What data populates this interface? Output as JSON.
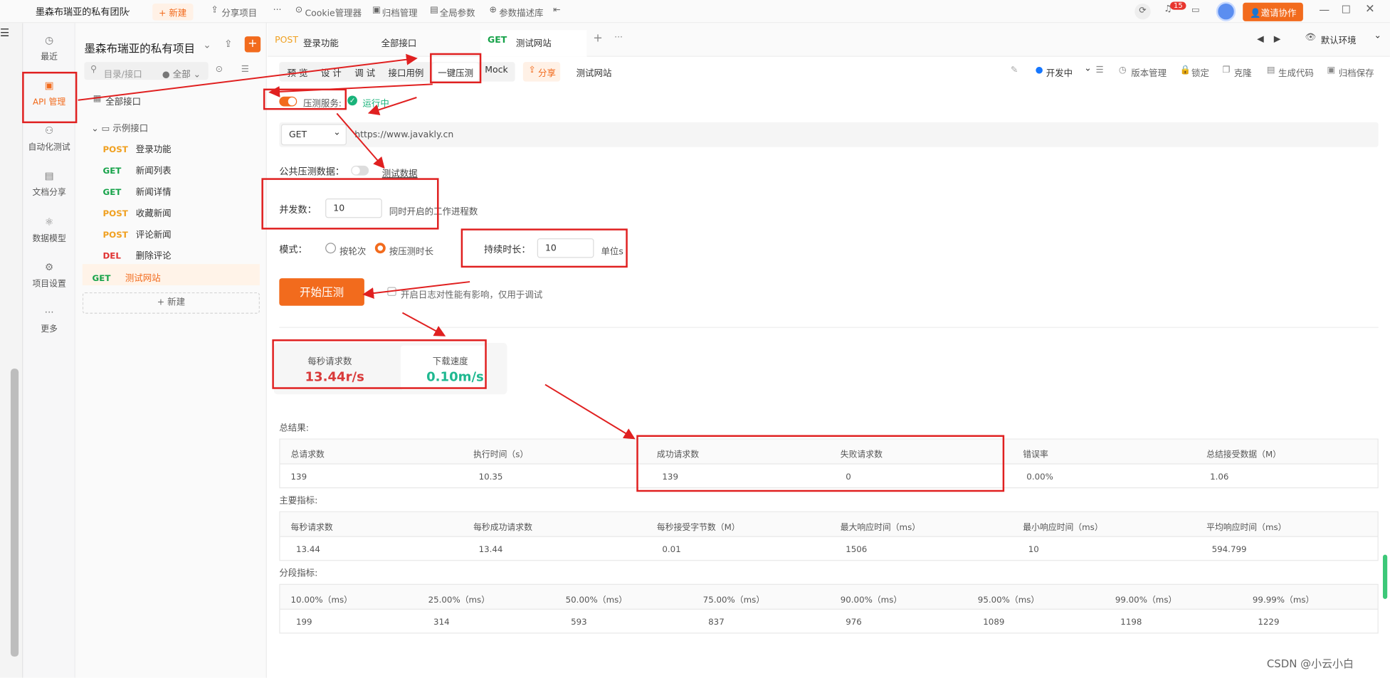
{
  "window": {
    "team": "墨森布瑞亚的私有团队",
    "new_btn": "+ 新建",
    "share": "分享项目",
    "more": "···",
    "cookie": "Cookie管理器",
    "archive": "归档管理",
    "global": "全局参数",
    "param_lib": "参数描述库",
    "notif_count": "15",
    "invite": "邀请协作"
  },
  "rail": {
    "recent": "最近",
    "api": "API 管理",
    "auto": "自动化测试",
    "doc": "文档分享",
    "model": "数据模型",
    "settings": "项目设置",
    "more": "更多"
  },
  "sidebar": {
    "project": "墨森布瑞亚的私有项目",
    "search_placeholder": "目录/接口",
    "filter": "全部",
    "all_api": "全部接口",
    "folder": "示例接口",
    "items": [
      {
        "m": "POST",
        "n": "登录功能"
      },
      {
        "m": "GET",
        "n": "新闻列表"
      },
      {
        "m": "GET",
        "n": "新闻详情"
      },
      {
        "m": "POST",
        "n": "收藏新闻"
      },
      {
        "m": "POST",
        "n": "评论新闻"
      },
      {
        "m": "DEL",
        "n": "删除评论"
      },
      {
        "m": "GET",
        "n": "测试网站"
      }
    ],
    "add": "+ 新建"
  },
  "tabs": {
    "t1_method": "POST",
    "t1_name": "登录功能",
    "t2_name": "全部接口",
    "t3_method": "GET",
    "t3_name": "测试网站",
    "env": "默认环境"
  },
  "subtabs": {
    "preview": "预 览",
    "design": "设 计",
    "debug": "调 试",
    "cases": "接口用例",
    "stress": "一键压测",
    "mock": "Mock",
    "share": "分享",
    "name": "测试网站",
    "status": "开发中",
    "version": "版本管理",
    "lock": "锁定",
    "clone": "克隆",
    "gen": "生成代码",
    "archive_save": "归档保存"
  },
  "stress": {
    "service_label": "压测服务:",
    "running": "运行中",
    "method": "GET",
    "url": "https://www.javakly.cn",
    "public_label": "公共压测数据：",
    "test_data": "测试数据",
    "concurrency_label": "并发数：",
    "concurrency": "10",
    "concurrency_hint": "同时开启的工作进程数",
    "mode_label": "模式：",
    "mode_rounds": "按轮次",
    "mode_duration": "按压测时长",
    "duration_label": "持续时长：",
    "duration": "10",
    "unit": "单位s",
    "start": "开始压测",
    "log_hint": "开启日志对性能有影响，仅用于调试"
  },
  "metrics": {
    "rps_label": "每秒请求数",
    "rps": "13.44r/s",
    "dl_label": "下载速度",
    "dl": "0.10m/s"
  },
  "results": {
    "total_title": "总结果:",
    "total_headers": [
      "总请求数",
      "执行时间（s）",
      "成功请求数",
      "失败请求数",
      "错误率",
      "总结接受数据（M）"
    ],
    "total_values": [
      "139",
      "10.35",
      "139",
      "0",
      "0.00%",
      "1.06"
    ],
    "main_title": "主要指标:",
    "main_headers": [
      "每秒请求数",
      "每秒成功请求数",
      "每秒接受字节数（M）",
      "最大响应时间（ms）",
      "最小响应时间（ms）",
      "平均响应时间（ms）"
    ],
    "main_values": [
      "13.44",
      "13.44",
      "0.01",
      "1506",
      "10",
      "594.799"
    ],
    "seg_title": "分段指标:",
    "seg_headers": [
      "10.00%（ms）",
      "25.00%（ms）",
      "50.00%（ms）",
      "75.00%（ms）",
      "90.00%（ms）",
      "95.00%（ms）",
      "99.00%（ms）",
      "99.99%（ms）"
    ],
    "seg_values": [
      "199",
      "314",
      "593",
      "837",
      "976",
      "1089",
      "1198",
      "1229"
    ]
  },
  "watermark": "CSDN @小云小白"
}
